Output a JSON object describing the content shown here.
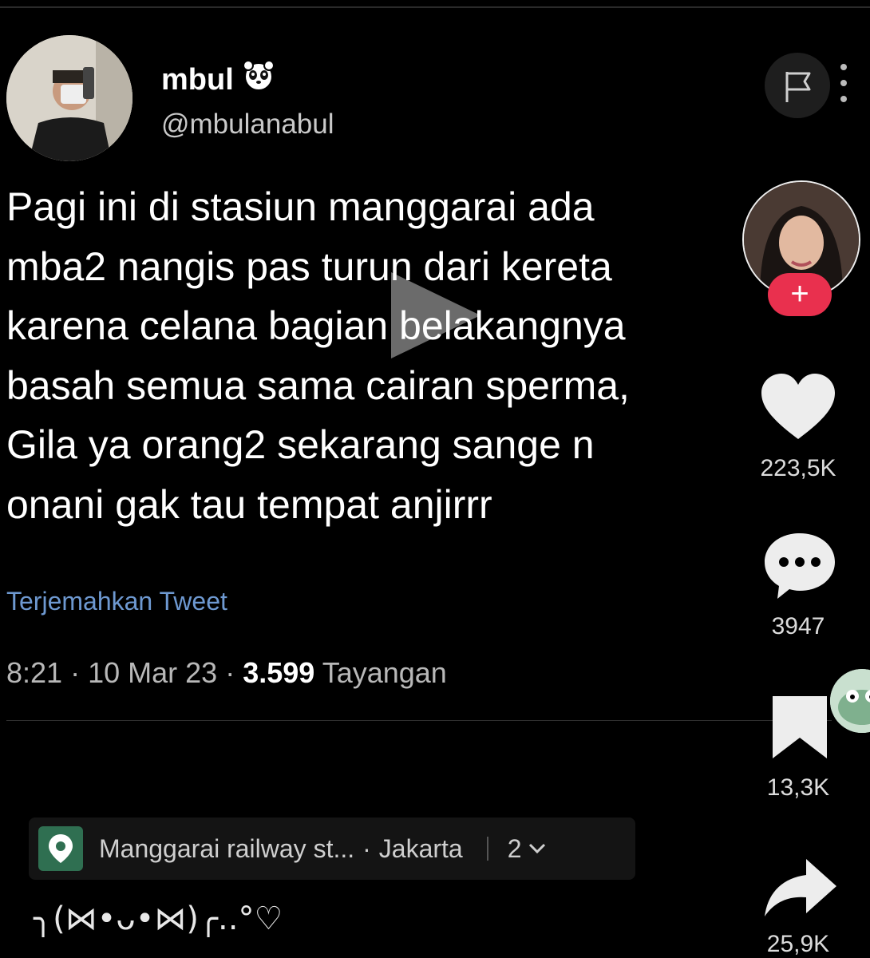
{
  "tweet": {
    "display_name": "mbul",
    "handle": "@mbulanabul",
    "text": "Pagi ini di stasiun manggarai ada\nmba2 nangis pas turun dari kereta\nkarena celana bagian belakangnya\nbasah semua sama cairan sperma,\nGila ya orang2 sekarang sange n\nonani gak tau tempat anjirrr",
    "translate_link": "Terjemahkan Tweet",
    "time": "8:21",
    "date": "10 Mar 23",
    "views_count": "3.599",
    "views_label": "Tayangan",
    "separator": "·"
  },
  "sidebar": {
    "follow_label": "+",
    "likes": "223,5K",
    "comments": "3947",
    "saves": "13,3K",
    "shares": "25,9K"
  },
  "location": {
    "place": "Manggarai railway st...",
    "separator": "·",
    "city": "Jakarta",
    "count": "2"
  },
  "caption": "╮(⋈•ᴗ•⋈)╭..°♡",
  "icons": {
    "verified_badge": "panda-icon",
    "flag": "flag-icon",
    "more": "kebab-icon",
    "play": "play-icon",
    "like": "heart-icon",
    "comment": "comment-icon",
    "save": "bookmark-icon",
    "share": "share-icon",
    "location": "location-pin-icon"
  },
  "colors": {
    "background": "#000000",
    "link": "#6e99d1",
    "follow_button": "#e9304e",
    "location_pin": "#2f6f51"
  }
}
